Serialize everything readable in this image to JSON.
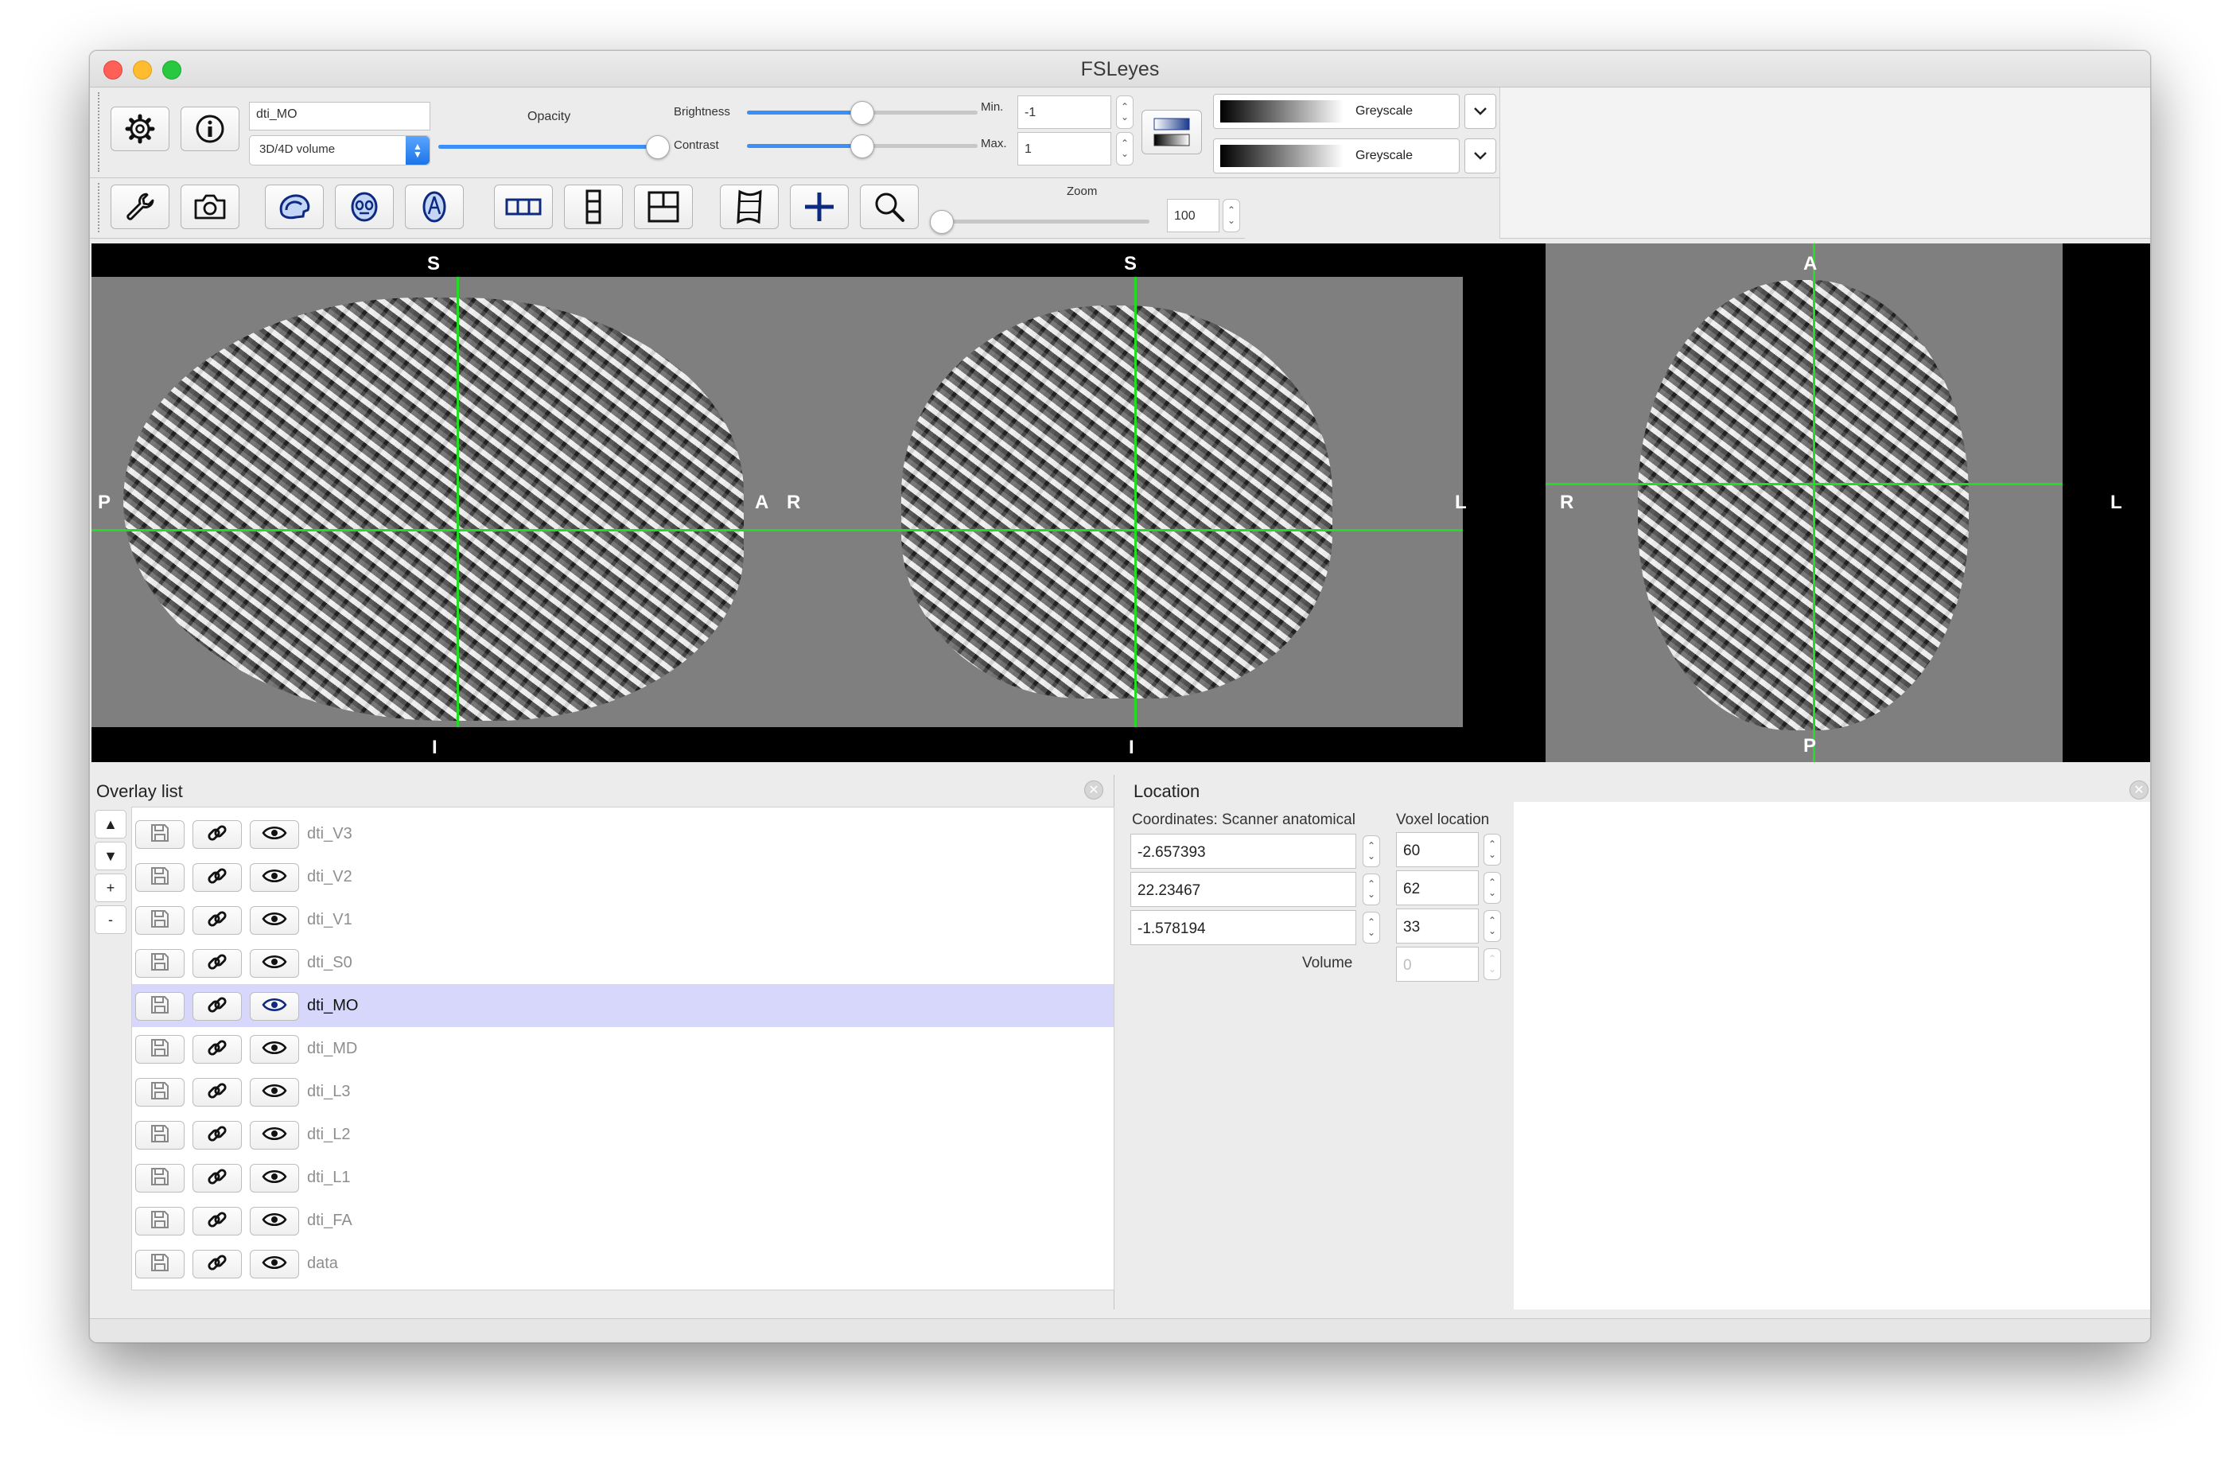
{
  "window": {
    "title": "FSLeyes"
  },
  "toolbar_overlay": {
    "overlay_name": "dti_MO",
    "overlay_type": "3D/4D volume",
    "opacity_label": "Opacity",
    "opacity_value": 1.0,
    "brightness_label": "Brightness",
    "brightness_value": 0.5,
    "contrast_label": "Contrast",
    "contrast_value": 0.5,
    "min_label": "Min.",
    "min_value": "-1",
    "max_label": "Max.",
    "max_value": "1",
    "colormap_1": "Greyscale",
    "colormap_2": "Greyscale"
  },
  "toolbar_ortho": {
    "zoom_label": "Zoom",
    "zoom_value": "100"
  },
  "view": {
    "sagittal": {
      "top": "S",
      "bottom": "I",
      "left": "P",
      "right": "A"
    },
    "coronal": {
      "top": "S",
      "bottom": "I",
      "left": "R",
      "right": "L"
    },
    "axial": {
      "top": "A",
      "bottom": "P",
      "left": "R",
      "right": "L"
    },
    "crosshair_color": "#22dd22"
  },
  "overlay_list": {
    "title": "Overlay list",
    "side_buttons": [
      "▲",
      "▼",
      "+",
      "-"
    ],
    "items": [
      {
        "name": "dti_V3",
        "selected": false
      },
      {
        "name": "dti_V2",
        "selected": false
      },
      {
        "name": "dti_V1",
        "selected": false
      },
      {
        "name": "dti_S0",
        "selected": false
      },
      {
        "name": "dti_MO",
        "selected": true
      },
      {
        "name": "dti_MD",
        "selected": false
      },
      {
        "name": "dti_L3",
        "selected": false
      },
      {
        "name": "dti_L2",
        "selected": false
      },
      {
        "name": "dti_L1",
        "selected": false
      },
      {
        "name": "dti_FA",
        "selected": false
      },
      {
        "name": "data",
        "selected": false
      }
    ]
  },
  "location": {
    "title": "Location",
    "coords_label": "Coordinates: Scanner anatomical",
    "voxel_label": "Voxel location",
    "coords": [
      "-2.657393",
      "22.23467",
      "-1.578194"
    ],
    "voxels": [
      "60",
      "62",
      "33"
    ],
    "volume_label": "Volume",
    "volume_value": "0"
  }
}
